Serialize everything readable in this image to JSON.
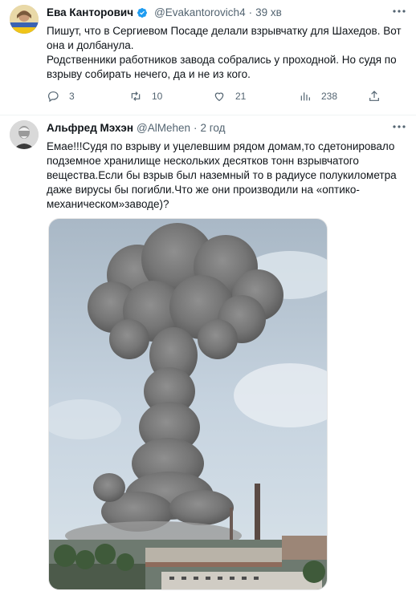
{
  "tweets": [
    {
      "author_name": "Ева Канторович",
      "handle": "@Evakantorovich4",
      "separator": "·",
      "time": "39 хв",
      "text_lines": [
        "Пишут, что в Сергиевом Посаде делали взрывчатку для Шахедов. Вот она и долбанула.",
        "Родственники работников завода собрались у проходной. Но судя по взрыву собирать нечего, да и не из кого."
      ],
      "reply_count": "3",
      "retweet_count": "10",
      "like_count": "21",
      "views_count": "238"
    },
    {
      "author_name": "Альфред Мэхэн",
      "handle": "@AlMehen",
      "separator": "·",
      "time": "2 год",
      "text": "Емае!!!Судя по взрыву и уцелевшим рядом домам,то сдетонировало подземное хранилище нескольких десятков тонн взрывчатого вещества.Если бы взрыв был наземный то в радиусе полукилометра даже вирусы бы погибли.Что же они производили на «оптико-механическом»заводе)?"
    }
  ],
  "icons": {
    "verified": "verified-badge-icon",
    "more": "more-options-icon",
    "reply": "reply-icon",
    "retweet": "retweet-icon",
    "like": "like-icon",
    "views": "views-icon",
    "share": "share-icon"
  },
  "colors": {
    "verified_blue": "#1d9bf0",
    "secondary_text": "#536471",
    "divider": "#eff3f4"
  }
}
